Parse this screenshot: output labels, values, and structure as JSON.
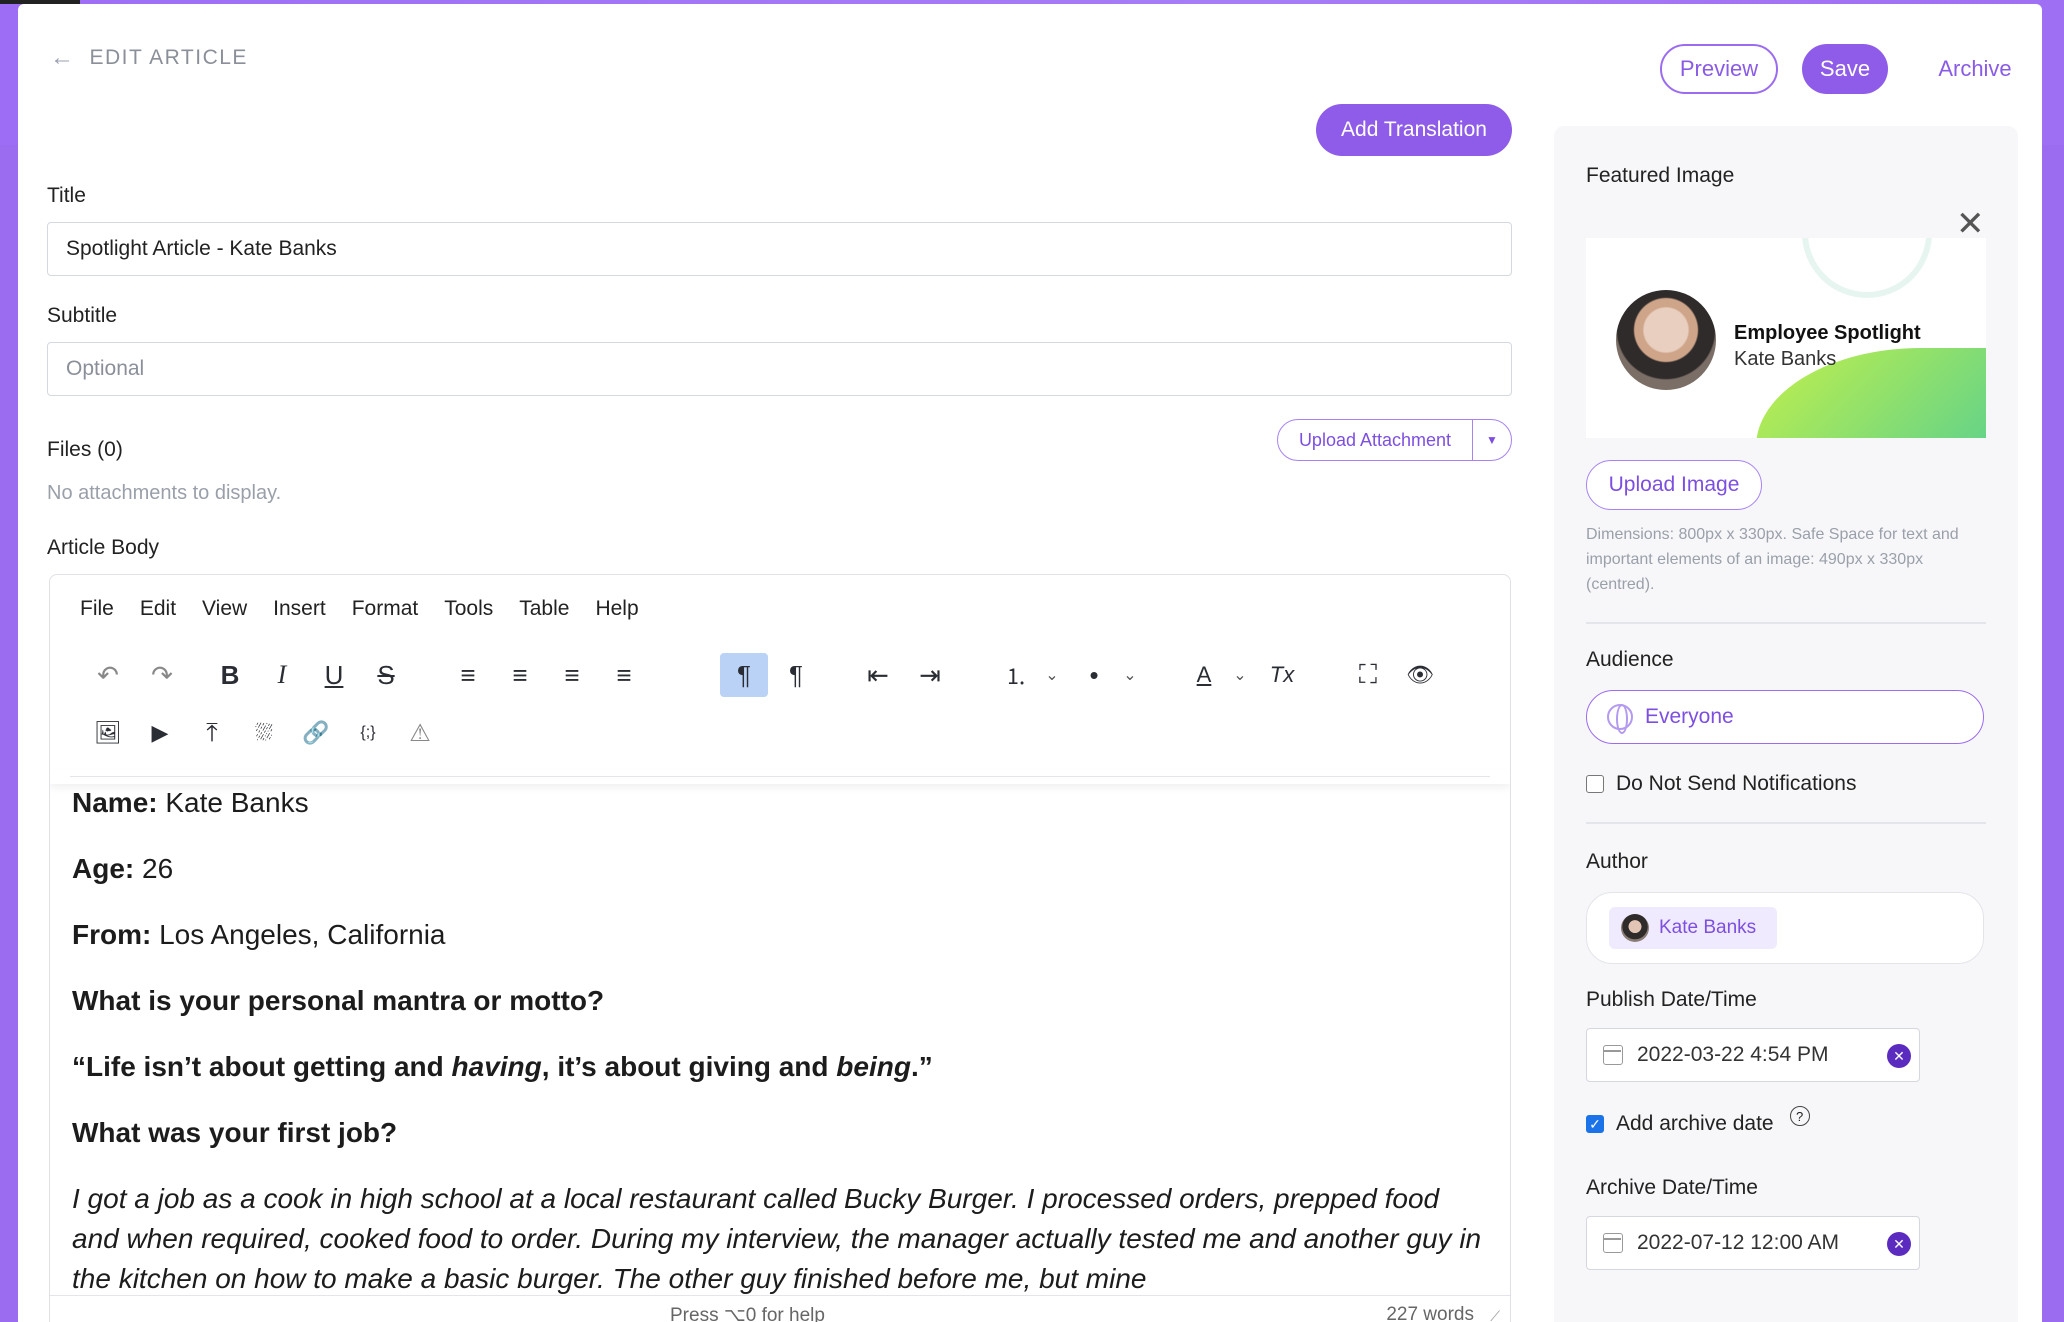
{
  "header": {
    "back_label": "EDIT ARTICLE",
    "preview_label": "Preview",
    "save_label": "Save",
    "archive_label": "Archive",
    "add_translation_label": "Add Translation"
  },
  "form": {
    "title_label": "Title",
    "title_value": "Spotlight Article - Kate Banks",
    "subtitle_label": "Subtitle",
    "subtitle_placeholder": "Optional",
    "files_label": "Files (0)",
    "files_empty": "No attachments to display.",
    "upload_attachment_label": "Upload Attachment",
    "article_body_label": "Article Body"
  },
  "editor": {
    "menu": [
      "File",
      "Edit",
      "View",
      "Insert",
      "Format",
      "Tools",
      "Table",
      "Help"
    ],
    "icons": {
      "undo": "↶",
      "redo": "↷",
      "bold": "B",
      "italic": "I",
      "underline": "U",
      "strike": "S",
      "align_left": "≡",
      "align_center": "≡",
      "align_right": "≡",
      "justify": "≡",
      "ltr": "¶",
      "rtl": "¶",
      "outdent": "⇤",
      "indent": "⇥",
      "numlist": "⒈",
      "bullist": "•",
      "caret": "⌄",
      "textcolor": "A",
      "clearformat": "Tx",
      "fullscreen": "⛶",
      "preview": "👁",
      "image": "🖼",
      "media": "▶",
      "upload": "⤒",
      "stamp": "⛆",
      "link": "🔗",
      "code": "{;}",
      "warning": "⚠"
    },
    "content": {
      "name_label": "Name:",
      "name_value": " Kate Banks",
      "age_label": "Age:",
      "age_value": " 26",
      "from_label": "From:",
      "from_value": " Los Angeles, California",
      "q1": "What is your personal mantra or motto?",
      "quote_a": "“Life isn’t about getting and ",
      "quote_b": "having",
      "quote_c": ", it’s about giving and ",
      "quote_d": "being",
      "quote_e": ".”",
      "q2": "What was your first job?",
      "answer": "I got a job as a cook in high school at a local restaurant called Bucky Burger. I processed orders, prepped food and when required, cooked food to order. During my interview, the manager actually tested me and another guy in the kitchen on how to make a basic burger. The other guy finished before me, but mine"
    },
    "status_help": "Press ⌥0 for help",
    "word_count": "227 words"
  },
  "sidebar": {
    "featured_label": "Featured Image",
    "featured_title": "Employee Spotlight",
    "featured_name": "Kate Banks",
    "upload_image_label": "Upload Image",
    "dimensions_text": "Dimensions: 800px x 330px. Safe Space for text and important elements of an image: 490px x 330px (centred).",
    "audience_label": "Audience",
    "audience_value": "Everyone",
    "no_notify_label": "Do Not Send Notifications",
    "author_label": "Author",
    "author_name": "Kate Banks",
    "publish_label": "Publish Date/Time",
    "publish_value": "2022-03-22 4:54 PM",
    "add_archive_label": "Add archive date",
    "archive_label": "Archive Date/Time",
    "archive_value": "2022-07-12 12:00 AM"
  },
  "colors": {
    "accent": "#8e5ce8",
    "brand_bg": "#9b6cf0"
  }
}
